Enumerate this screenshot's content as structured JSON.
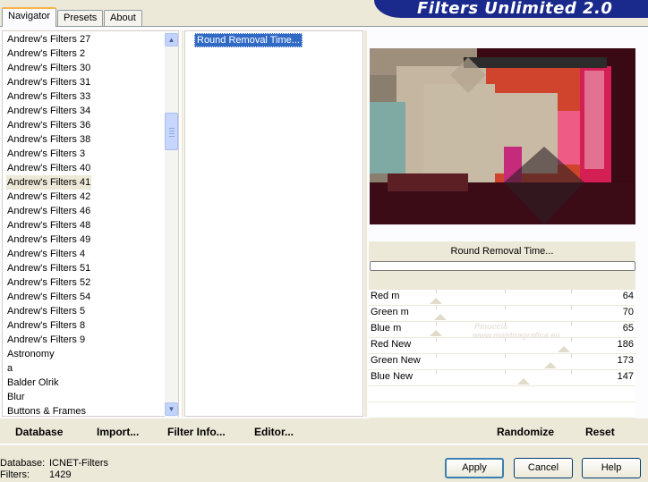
{
  "app": {
    "title": "Filters Unlimited 2.0"
  },
  "tabs": [
    {
      "label": "Navigator",
      "active": true
    },
    {
      "label": "Presets",
      "active": false
    },
    {
      "label": "About",
      "active": false
    }
  ],
  "categories": [
    "Andrew's Filters 27",
    "Andrew's Filters 2",
    "Andrew's Filters 30",
    "Andrew's Filters 31",
    "Andrew's Filters 33",
    "Andrew's Filters 34",
    "Andrew's Filters 36",
    "Andrew's Filters 38",
    "Andrew's Filters 3",
    "Andrew's Filters 40",
    "Andrew's Filters 41",
    "Andrew's Filters 42",
    "Andrew's Filters 46",
    "Andrew's Filters 48",
    "Andrew's Filters 49",
    "Andrew's Filters 4",
    "Andrew's Filters 51",
    "Andrew's Filters 52",
    "Andrew's Filters 54",
    "Andrew's Filters 5",
    "Andrew's Filters 8",
    "Andrew's Filters 9",
    "Astronomy",
    "a",
    "Balder Olrik",
    "Blur",
    "Buttons & Frames"
  ],
  "selected_category": "Andrew's Filters 41",
  "filters": [
    "Round Removal Time..."
  ],
  "current_filter": "Round Removal Time...",
  "sliders": [
    {
      "label": "Red m",
      "value": "64",
      "pos": 0.25
    },
    {
      "label": "Green m",
      "value": "70",
      "pos": 0.27
    },
    {
      "label": "Blue m",
      "value": "65",
      "pos": 0.25
    },
    {
      "label": "Red New",
      "value": "186",
      "pos": 0.73
    },
    {
      "label": "Green New",
      "value": "173",
      "pos": 0.68
    },
    {
      "label": "Blue New",
      "value": "147",
      "pos": 0.58
    }
  ],
  "actions": {
    "database": "Database",
    "import": "Import...",
    "filter_info": "Filter Info...",
    "editor": "Editor...",
    "randomize": "Randomize",
    "reset": "Reset"
  },
  "status": {
    "database_label": "Database:",
    "database_value": "ICNET-Filters",
    "filters_label": "Filters:",
    "filters_value": "1429"
  },
  "buttons": {
    "apply": "Apply",
    "cancel": "Cancel",
    "help": "Help"
  },
  "watermark": {
    "line1": "Pinuccia",
    "line2": "www.maldiragrafica.eu"
  },
  "colors": {
    "banner": "#1a2a8c",
    "selection": "#316ac5",
    "window": "#ece9d8"
  }
}
